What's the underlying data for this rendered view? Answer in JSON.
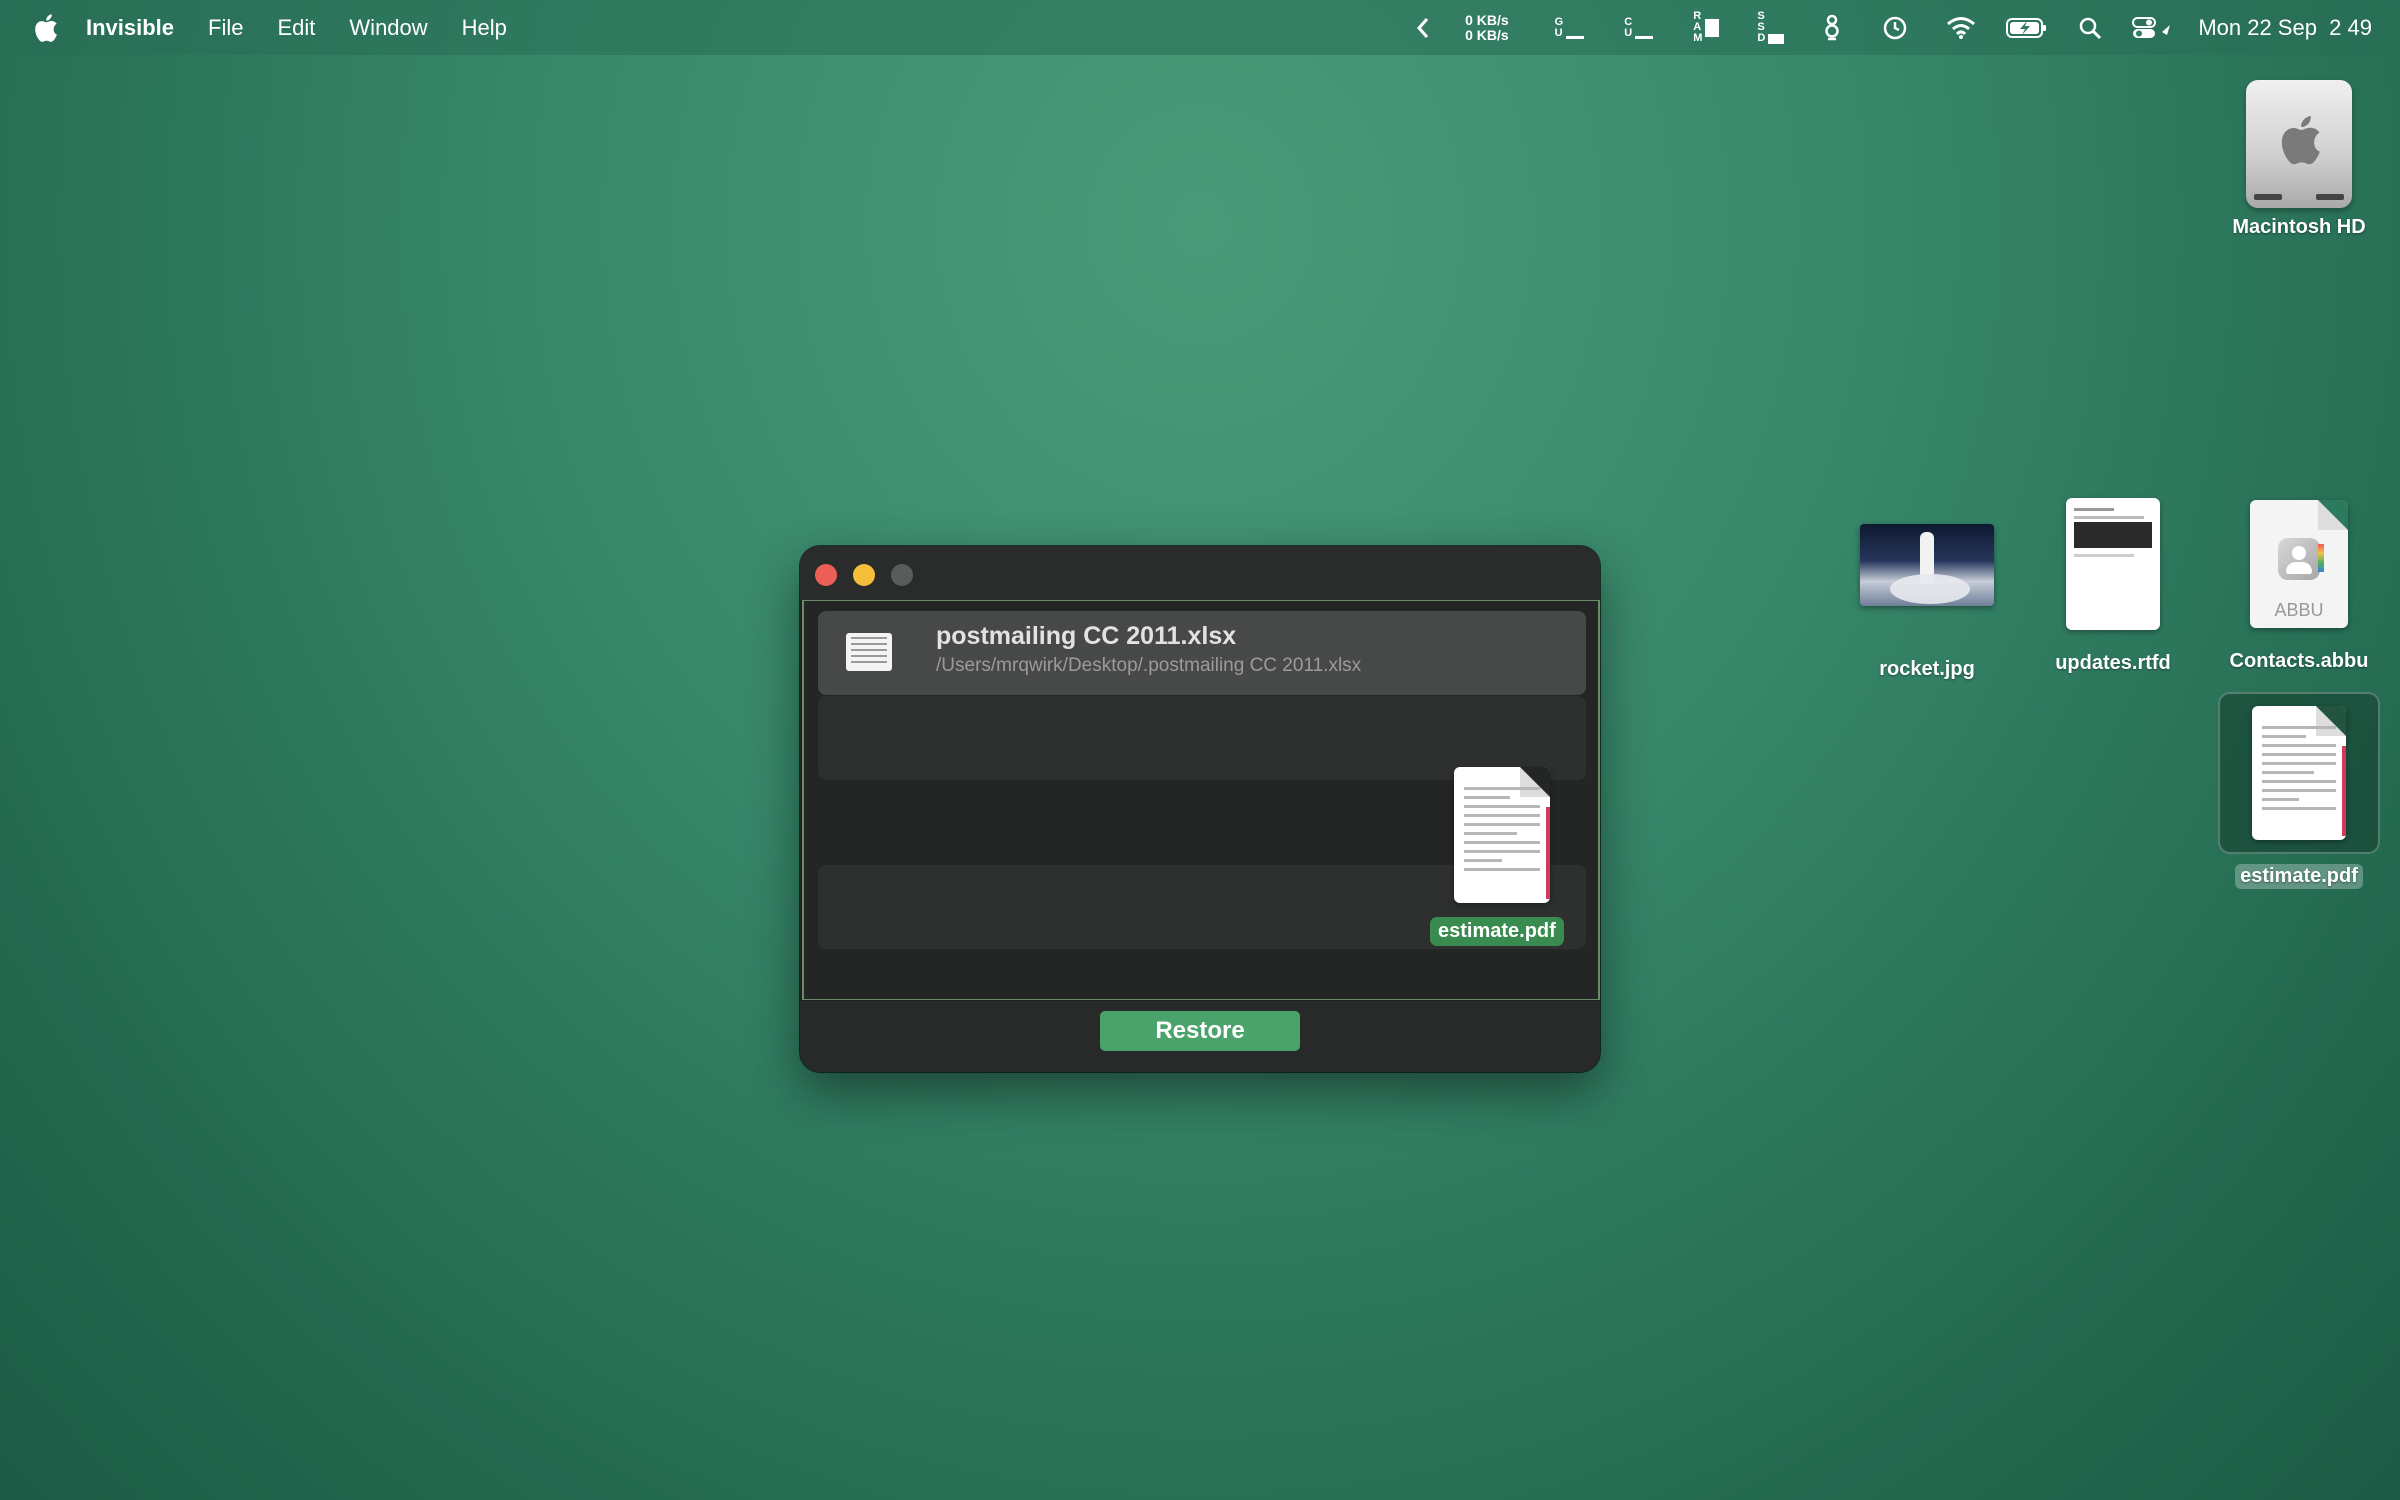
{
  "menubar": {
    "app_name": "Invisible",
    "menus": [
      "File",
      "Edit",
      "Window",
      "Help"
    ],
    "net_up": "0 KB/s",
    "net_down": "0 KB/s",
    "gpu_label": [
      "G",
      "U"
    ],
    "cpu_label": [
      "C",
      "U"
    ],
    "ram_label": [
      "R",
      "A",
      "M"
    ],
    "ssd_label": [
      "S",
      "S",
      "D"
    ],
    "clock": "Mon 22 Sep  2 49"
  },
  "desktop": {
    "icons": [
      {
        "label": "Macintosh HD",
        "icon": "hard-drive-icon"
      },
      {
        "label": "rocket.jpg",
        "icon": "image-file-icon"
      },
      {
        "label": "updates.rtfd",
        "icon": "document-icon"
      },
      {
        "label": "Contacts.abbu",
        "icon": "contacts-file-icon",
        "badge": "ABBU"
      },
      {
        "label": "estimate.pdf",
        "icon": "pdf-file-icon",
        "selected": true
      }
    ]
  },
  "window": {
    "files": [
      {
        "name": "postmailing CC 2011.xlsx",
        "path": "/Users/mrqwirk/Desktop/.postmailing CC 2011.xlsx"
      }
    ],
    "dragging_file": "estimate.pdf",
    "restore_label": "Restore"
  },
  "colors": {
    "accent": "#4aa36a",
    "close": "#ec5f57",
    "minimize": "#f4bd3a"
  }
}
